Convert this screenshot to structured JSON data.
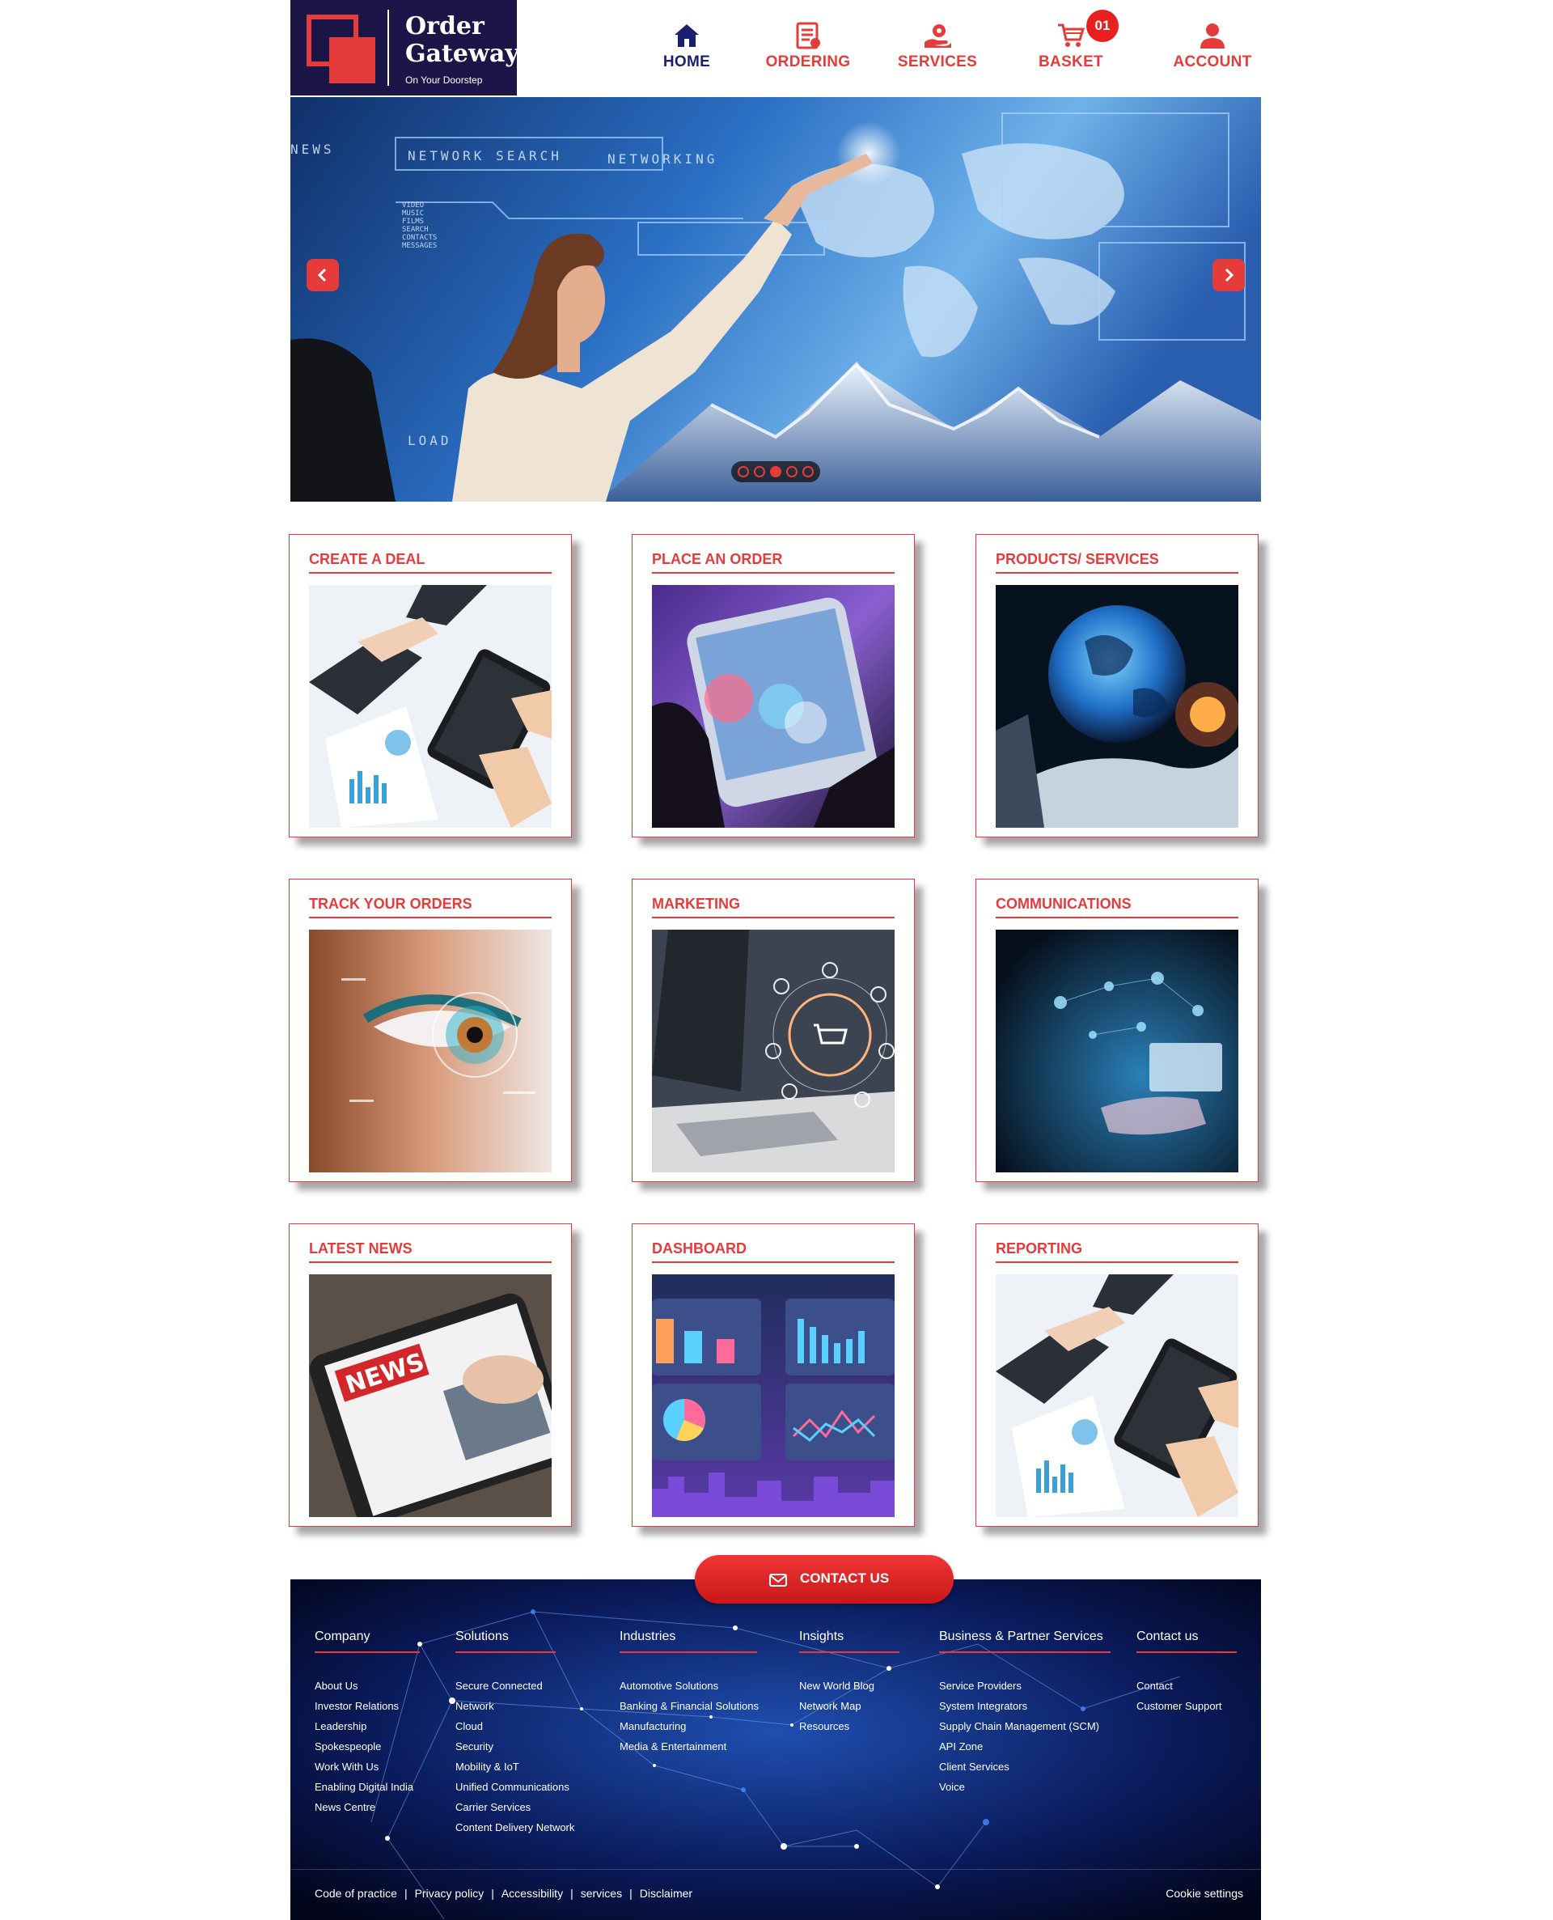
{
  "brand": {
    "title": "Order Gateway",
    "tagline": "On Your Doorstep"
  },
  "nav": {
    "items": [
      {
        "label": "HOME",
        "icon": "home-icon",
        "active": true
      },
      {
        "label": "ORDERING",
        "icon": "order-list-icon"
      },
      {
        "label": "SERVICES",
        "icon": "service-hand-icon"
      },
      {
        "label": "BASKET",
        "icon": "cart-icon",
        "badge": "01"
      },
      {
        "label": "ACCOUNT",
        "icon": "user-icon"
      }
    ]
  },
  "hero": {
    "overlay_text": [
      "NETWORK SEARCH",
      "NETWORKING",
      "NEWS",
      "VIDEO",
      "MUSIC",
      "FILMS",
      "SEARCH",
      "CONTACTS",
      "MESSAGES",
      "LOAD"
    ],
    "slides": 5,
    "active_slide": 3
  },
  "cards": [
    {
      "title": "CREATE A DEAL"
    },
    {
      "title": "PLACE AN ORDER"
    },
    {
      "title": "PRODUCTS/ SERVICES"
    },
    {
      "title": "TRACK YOUR ORDERS"
    },
    {
      "title": "MARKETING"
    },
    {
      "title": "COMMUNICATIONS"
    },
    {
      "title": "LATEST NEWS",
      "image_text": "NEWS"
    },
    {
      "title": "DASHBOARD"
    },
    {
      "title": "REPORTING"
    }
  ],
  "contact_button": {
    "label": "CONTACT US"
  },
  "footer": {
    "columns": [
      {
        "heading": "Company",
        "links": [
          "About Us",
          "Investor Relations",
          "Leadership",
          "Spokespeople",
          "Work With Us",
          "Enabling Digital India",
          "News Centre"
        ]
      },
      {
        "heading": "Solutions",
        "links": [
          "Secure Connected",
          "Network",
          "Cloud",
          "Security",
          "Mobility & IoT",
          "Unified Communications",
          "Carrier Services",
          "Content Delivery Network"
        ]
      },
      {
        "heading": "Industries",
        "links": [
          "Automotive Solutions",
          "Banking & Financial Solutions",
          "Manufacturing",
          "Media & Entertainment"
        ]
      },
      {
        "heading": "Insights",
        "links": [
          "New World Blog",
          "Network Map",
          "Resources"
        ]
      },
      {
        "heading": "Business & Partner Services",
        "links": [
          "Service Providers",
          "System Integrators",
          "Supply Chain Management (SCM)",
          "API Zone",
          "Client Services",
          "Voice"
        ]
      },
      {
        "heading": "Contact us",
        "links": [
          "Contact",
          "Customer Support"
        ]
      }
    ],
    "legal_links": [
      "Code of practice",
      "Privacy policy",
      "Accessibility",
      "services",
      "Disclaimer"
    ],
    "cookie_label": "Cookie settings"
  },
  "colors": {
    "accent": "#e63b3b",
    "navy": "#1b1647",
    "active_nav": "#1b1f6e",
    "footer_bg": "#04082a"
  }
}
